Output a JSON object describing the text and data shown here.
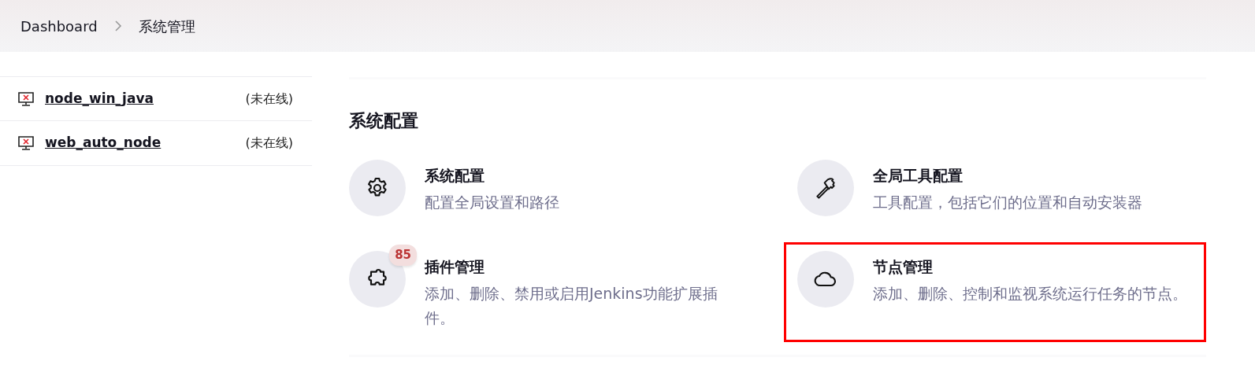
{
  "breadcrumb": [
    {
      "label": "Dashboard"
    },
    {
      "label": "系统管理"
    }
  ],
  "nodes": [
    {
      "name": "node_win_java",
      "status": "(未在线)"
    },
    {
      "name": "web_auto_node",
      "status": "(未在线)"
    }
  ],
  "section": {
    "title": "系统配置",
    "items": [
      {
        "kind": "gear",
        "title": "系统配置",
        "description": "配置全局设置和路径",
        "highlighted": false
      },
      {
        "kind": "hammer",
        "title": "全局工具配置",
        "description": "工具配置，包括它们的位置和自动安装器",
        "highlighted": false
      },
      {
        "kind": "puzzle",
        "title": "插件管理",
        "description": "添加、删除、禁用或启用Jenkins功能扩展插件。",
        "badge": "85",
        "highlighted": false
      },
      {
        "kind": "cloud",
        "title": "节点管理",
        "description": "添加、删除、控制和监视系统运行任务的节点。",
        "highlighted": true
      }
    ]
  }
}
